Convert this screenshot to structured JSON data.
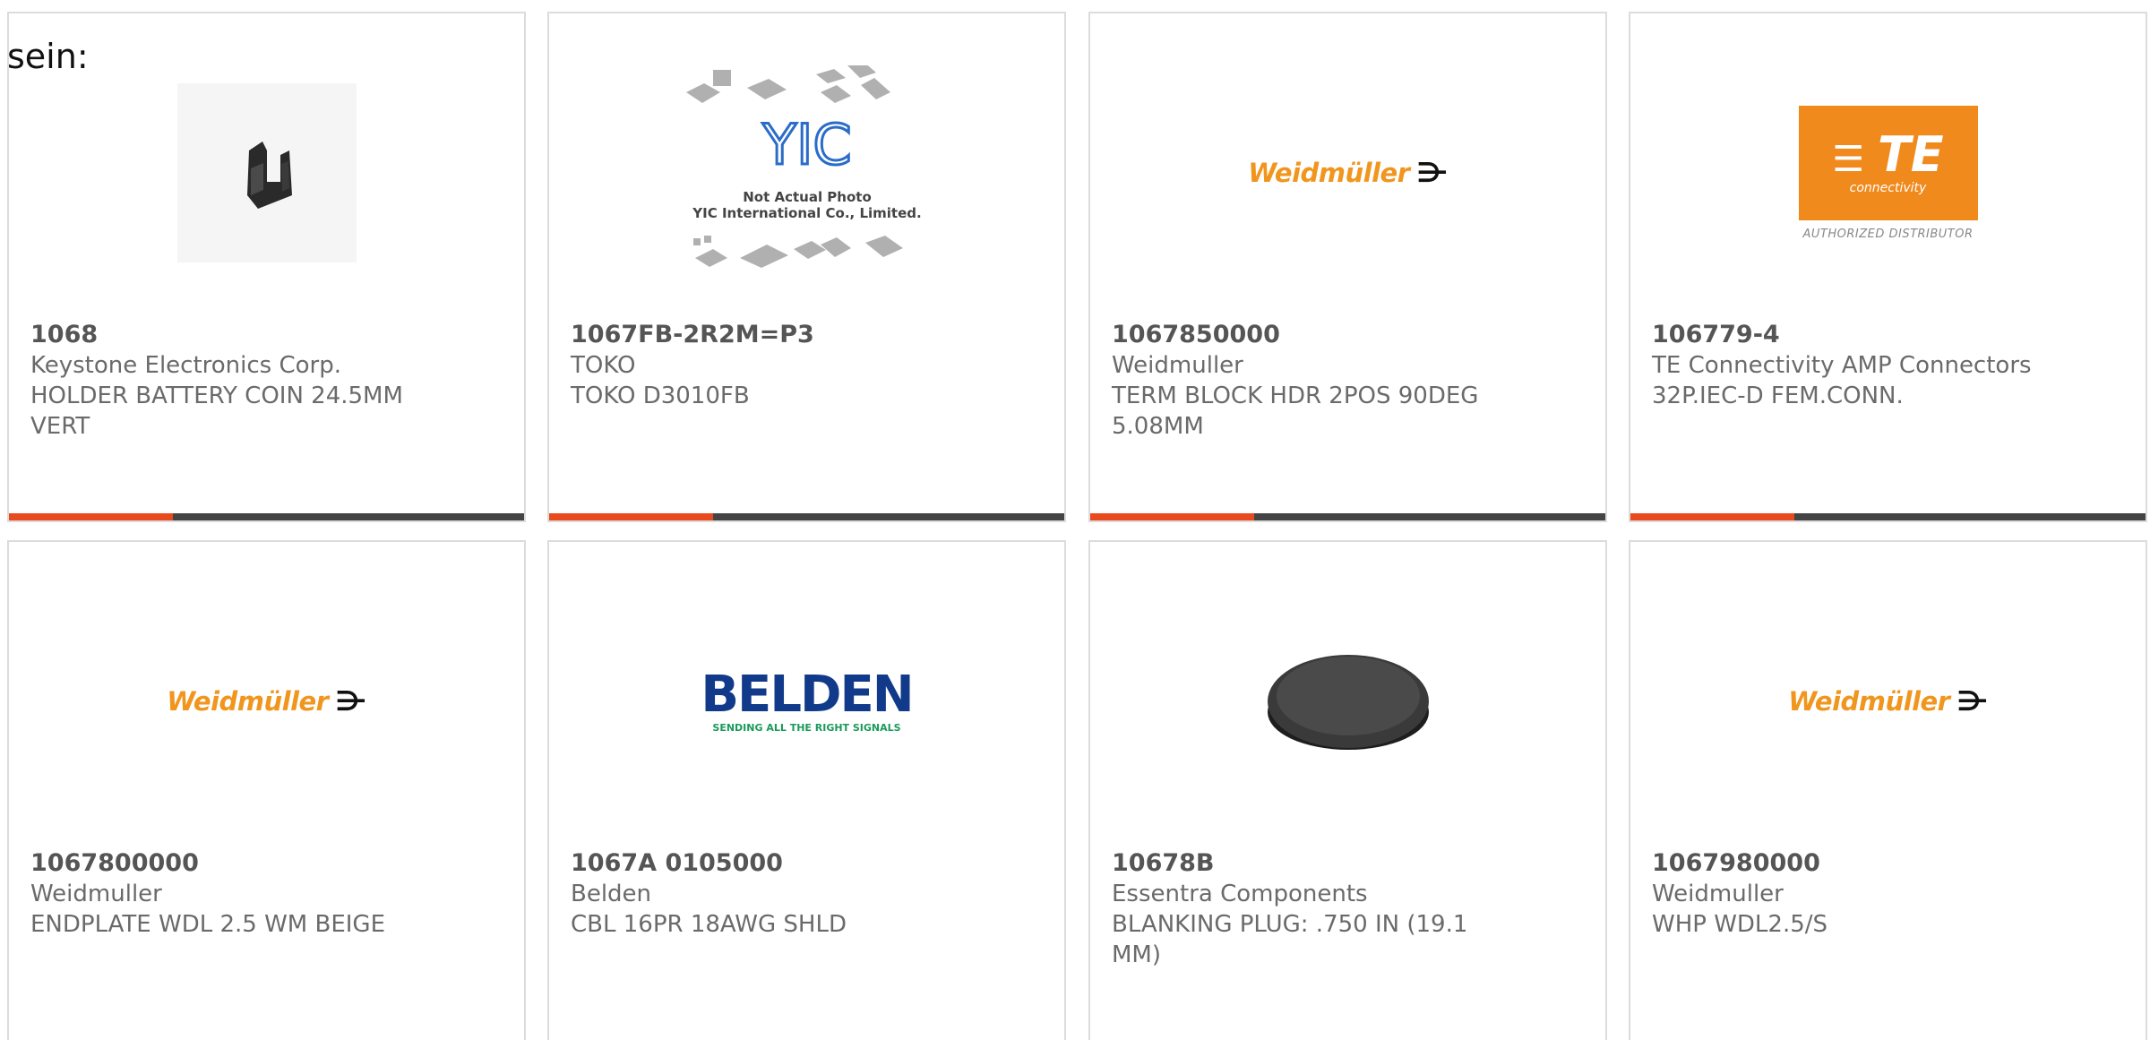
{
  "intro_text": "sein:",
  "products": [
    {
      "part": "1068",
      "brand": "Keystone Electronics Corp.",
      "desc": "HOLDER BATTERY COIN 24.5MM VERT",
      "image": "battery-holder-photo"
    },
    {
      "part": "1067FB-2R2M=P3",
      "brand": "TOKO",
      "desc": "TOKO D3010FB",
      "image": "yic-not-actual-photo",
      "image_caption_1": "Not Actual Photo",
      "image_caption_2": "YIC International Co., Limited.",
      "image_logo": "YIC"
    },
    {
      "part": "1067850000",
      "brand": "Weidmuller",
      "desc": "TERM BLOCK HDR 2POS 90DEG 5.08MM",
      "image": "weidmuller-logo",
      "logo_text": "Weidmüller"
    },
    {
      "part": "106779-4",
      "brand": "TE Connectivity AMP Connectors",
      "desc": "32P.IEC-D FEM.CONN.",
      "image": "te-connectivity-logo",
      "logo_text": "TE",
      "logo_sub": "connectivity",
      "logo_caption": "AUTHORIZED DISTRIBUTOR"
    },
    {
      "part": "1067800000",
      "brand": "Weidmuller",
      "desc": "ENDPLATE WDL 2.5 WM BEIGE",
      "image": "weidmuller-logo",
      "logo_text": "Weidmüller"
    },
    {
      "part": "1067A 0105000",
      "brand": "Belden",
      "desc": "CBL 16PR 18AWG SHLD",
      "image": "belden-logo",
      "logo_text": "BELDEN",
      "logo_tag": "SENDING ALL THE RIGHT SIGNALS"
    },
    {
      "part": "10678B",
      "brand": "Essentra Components",
      "desc": "BLANKING PLUG: .750 IN (19.1 MM)",
      "image": "blanking-plug-photo"
    },
    {
      "part": "1067980000",
      "brand": "Weidmuller",
      "desc": "WHP WDL2.5/S",
      "image": "weidmuller-logo",
      "logo_text": "Weidmüller"
    }
  ],
  "colors": {
    "accent": "#e84a1e",
    "bar": "#444444",
    "card_border": "#dcdcdc",
    "text_muted": "#6a6a6a",
    "weidmuller_orange": "#f0961e",
    "te_orange": "#f08a1d",
    "belden_blue": "#123a8a"
  }
}
